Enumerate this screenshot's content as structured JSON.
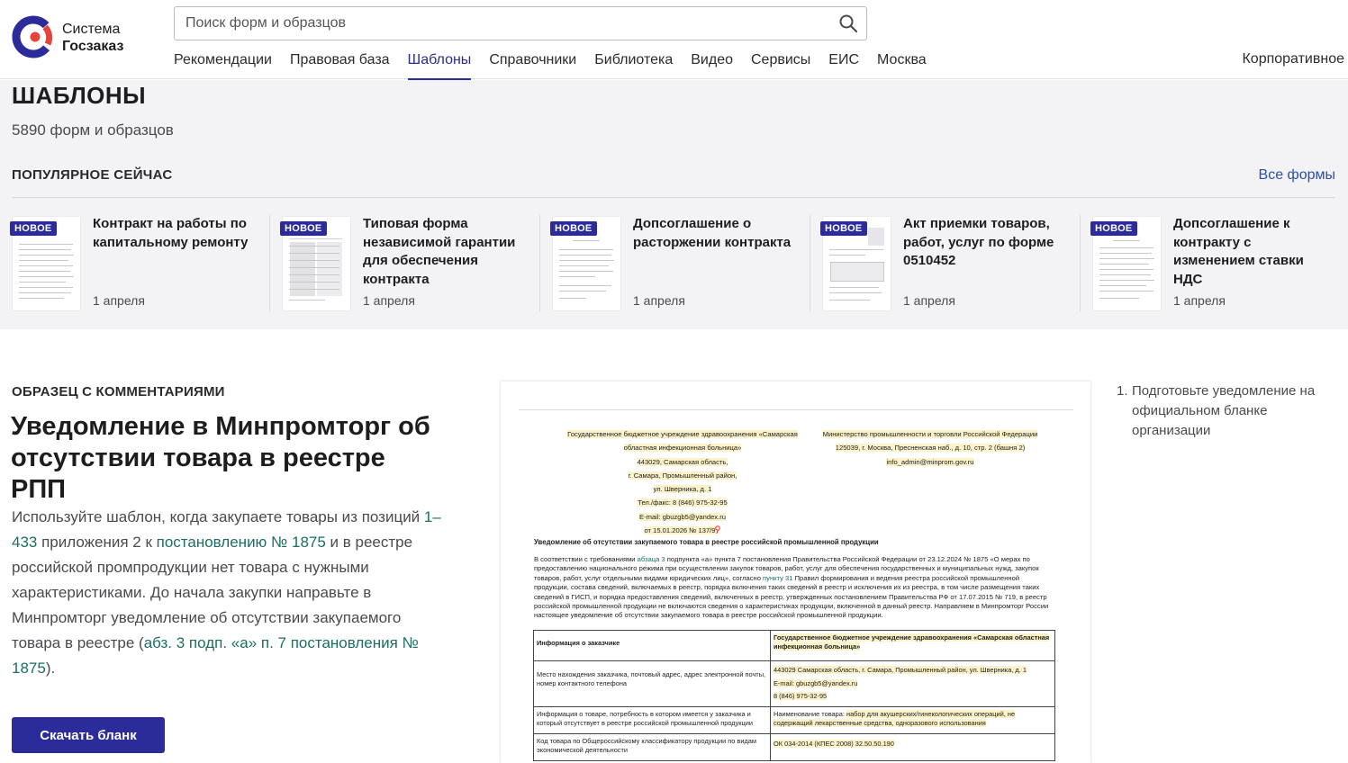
{
  "brand": {
    "line1": "Система",
    "line2": "Госзаказ",
    "colors": {
      "logo_blue": "#2b2b9a",
      "logo_red": "#e8433a"
    }
  },
  "search": {
    "placeholder": "Поиск форм и образцов",
    "value": ""
  },
  "nav": {
    "items": [
      {
        "label": "Рекомендации"
      },
      {
        "label": "Правовая база"
      },
      {
        "label": "Шаблоны",
        "active": true
      },
      {
        "label": "Справочники"
      },
      {
        "label": "Библиотека"
      },
      {
        "label": "Видео"
      },
      {
        "label": "Сервисы"
      },
      {
        "label": "ЕИС"
      },
      {
        "label": "Москва"
      }
    ],
    "right": "Корпоративное"
  },
  "page": {
    "title": "ШАБЛОНЫ",
    "count": "5890 форм и образцов"
  },
  "popular": {
    "title": "ПОПУЛЯРНОЕ СЕЙЧАС",
    "all_link": "Все формы",
    "cards": [
      {
        "badge": "НОВОЕ",
        "title": "Контракт на работы по капитальному ремонту",
        "date": "1 апреля"
      },
      {
        "badge": "НОВОЕ",
        "title": "Типовая форма независимой гарантии для обеспечения контракта",
        "date": "1 апреля"
      },
      {
        "badge": "НОВОЕ",
        "title": "Допсоглашение о расторжении контракта",
        "date": "1 апреля"
      },
      {
        "badge": "НОВОЕ",
        "title": "Акт приемки товаров, работ, услуг по форме 0510452",
        "date": "1 апреля"
      },
      {
        "badge": "НОВОЕ",
        "title": "Допсоглашение к контракту с изменением ставки НДС",
        "date": "1 апреля"
      }
    ]
  },
  "sample": {
    "label": "ОБРАЗЕЦ С КОММЕНТАРИЯМИ",
    "title": "Уведомление в Минпромторг об отсутствии товара в реестре РПП",
    "desc": {
      "t1": "Используйте шаблон, когда закупаете товары из позиций ",
      "l1": "1–433",
      "t2": " приложения 2 к ",
      "l2": "постановлению № 1875",
      "t3": " и в реестре российской промпродукции нет товара с нужными характеристиками. До начала закупки направьте в Минпромторг уведомление об отсутствии закупаемого товара в реестре (",
      "l3": "абз. 3 подп. «а» п. 7 постановления № 1875",
      "t4": ")."
    },
    "download_label": "Скачать бланк"
  },
  "doc": {
    "left": [
      "Государственное бюджетное учреждение здравоохранения «Самарская",
      "областная инфекционная больница»",
      "443029, Самарская область,",
      "г. Самара, Промышленный район,",
      "ул. Шверника, д. 1",
      "Тел./факс: 8 (846) 975-32-95",
      "E-mail: gbuzgb5@yandex.ru",
      "от 15.01.2026 № 137/9"
    ],
    "right": [
      "Министерство промышленности и торговли Российской Федерации",
      "125039, г. Москва, Пресненская наб., д. 10, стр. 2 (башня 2)",
      "info_admin@minprom.gov.ru"
    ],
    "heading": "Уведомление об отсутствии закупаемого товара в реестре российской промышленной продукции",
    "body": {
      "b1": "В соответствии с требованиями ",
      "bl1": "абзаца 3",
      "b2": " подпункта «а» пункта 7 постановления Правительства Российской Федерации от 23.12.2024 № 1875 «О мерах по предоставлению национального режима при осуществлении закупок товаров, работ, услуг для обеспечения государственных и муниципальных нужд, закупок товаров, работ, услуг отдельными видами юридических лиц», согласно ",
      "bl2": "пункту 31",
      "b3": " Правил формирования и ведения реестра российской промышленной продукции, состава сведений, включаемых в реестр, порядка включения таких сведений в реестр и исключения их из реестра, в том числе размещения таких сведений в ГИСП, и порядка предоставления сведений, включенных в реестр, утвержденных постановлением Правительства РФ от 17.07.2015 № 719, в реестр российской промышленной продукции не включаются сведения о характеристиках продукции, включенной в данный реестр. Направляем в Минпромторг России настоящее уведомление об отсутствии закупаемого товара в реестре российской промышленной продукции."
    },
    "table": [
      {
        "k": "Информация о заказчике",
        "v": "Государственное бюджетное учреждение здравоохранения «Самарская областная инфекционная больница»"
      },
      {
        "k": "Место нахождения заказчика, почтовый адрес, адрес электронной почты, номер контактного телефона",
        "v1": "443029 Самарская область, г. Самара, Промышленный район, ул. Шверника, д. 1",
        "v2": "E-mail: gbuzgb5@yandex.ru",
        "v3": "8 (846) 975-32-95"
      },
      {
        "k": "Информация о товаре, потребность в котором имеется у заказчика и который отсутствует в реестре российской промышленной продукции",
        "vp": "Наименование товара: ",
        "v": "набор для акушерских/гинекологических операций, не содержащий лекарственные средства, одноразового использования"
      },
      {
        "k": "Код товара по Общероссийскому классификатору продукции по видам экономической деятельности",
        "v": "ОК 034-2014 (КПЕС 2008) 32.50.50.190"
      }
    ]
  },
  "steps": [
    {
      "num": "1.",
      "text": "Подготовьте уведомление на официальном бланке организации"
    }
  ]
}
